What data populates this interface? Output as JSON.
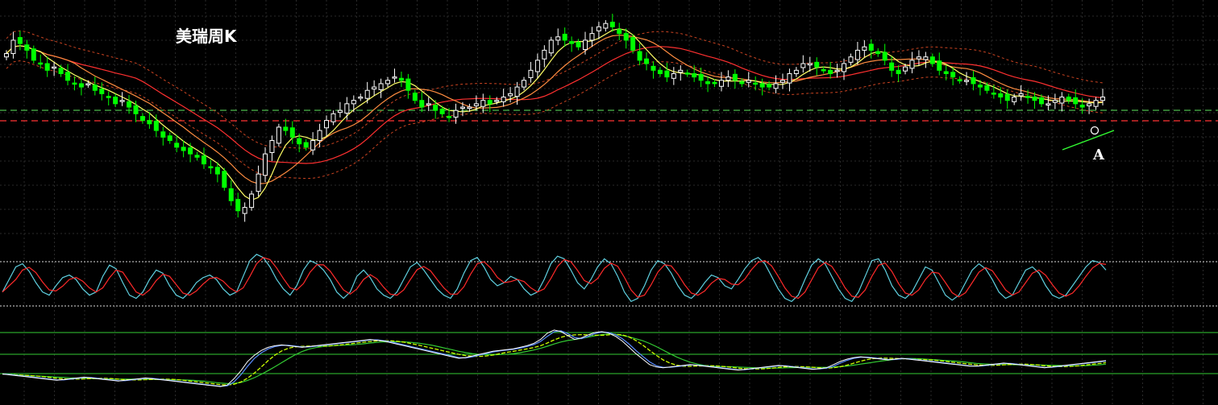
{
  "chart_data": {
    "type": "candlestick",
    "title": "美瑞周K",
    "annotation_label": "A",
    "colors": {
      "background": "#000000",
      "grid": "#2a2a2a",
      "up_candle": "#ffffff",
      "down_candle": "#00ff00",
      "ma_fast": "#ffff66",
      "ma_mid": "#ff8c40",
      "ma_slow": "#ff3030",
      "band": "#cc4422",
      "ref_green": "#4dbb4d",
      "ref_red": "#ff3333",
      "kdj_k": "#5fd0e0",
      "kdj_d": "#ff2a2a",
      "osc_1": "#ffffff",
      "osc_2": "#5a8cff",
      "osc_3": "#ccff00",
      "osc_4": "#33cc33",
      "annotation_line": "#33ff33",
      "annotation_marker": "#ffffff"
    },
    "panels": [
      "price",
      "stochastic",
      "oscillator"
    ],
    "grid": true,
    "close_series": [
      60,
      64,
      63,
      61,
      58,
      57,
      55,
      56,
      54,
      52,
      51,
      50,
      51,
      49,
      48,
      47,
      45,
      46,
      44,
      42,
      40,
      39,
      37,
      35,
      34,
      32,
      31,
      30,
      29,
      27,
      26,
      24,
      20,
      16,
      13,
      14,
      18,
      24,
      30,
      34,
      38,
      37,
      35,
      33,
      32,
      34,
      37,
      40,
      42,
      43,
      45,
      46,
      47,
      49,
      50,
      51,
      52,
      53,
      52,
      49,
      46,
      44,
      45,
      43,
      42,
      41,
      43,
      44,
      44,
      45,
      46,
      45,
      46,
      47,
      48,
      50,
      52,
      55,
      58,
      61,
      64,
      65,
      64,
      63,
      62,
      64,
      66,
      68,
      69,
      68,
      66,
      64,
      61,
      58,
      57,
      55,
      54,
      53,
      54,
      55,
      54,
      53,
      52,
      51,
      51,
      52,
      53,
      52,
      51,
      52,
      51,
      50,
      50,
      51,
      52,
      54,
      55,
      57,
      57,
      56,
      55,
      54,
      55,
      57,
      59,
      61,
      62,
      61,
      60,
      58,
      55,
      54,
      56,
      58,
      59,
      59,
      57,
      55,
      54,
      53,
      52,
      52,
      51,
      50,
      49,
      48,
      47,
      46,
      47,
      48,
      47,
      46,
      45,
      45,
      46,
      47,
      46,
      45,
      44,
      45,
      46,
      47
    ],
    "stochastic_k": [
      35,
      55,
      75,
      80,
      68,
      50,
      35,
      30,
      45,
      58,
      62,
      55,
      40,
      30,
      35,
      60,
      78,
      72,
      50,
      30,
      25,
      35,
      55,
      70,
      65,
      45,
      30,
      25,
      35,
      50,
      58,
      62,
      55,
      40,
      30,
      35,
      60,
      85,
      95,
      90,
      75,
      55,
      40,
      30,
      45,
      70,
      85,
      80,
      70,
      55,
      35,
      25,
      35,
      60,
      70,
      58,
      40,
      30,
      25,
      35,
      55,
      75,
      82,
      70,
      55,
      40,
      30,
      25,
      40,
      65,
      85,
      90,
      75,
      55,
      45,
      50,
      60,
      55,
      40,
      30,
      35,
      55,
      80,
      92,
      88,
      70,
      50,
      40,
      55,
      75,
      88,
      80,
      60,
      35,
      20,
      25,
      45,
      70,
      85,
      80,
      65,
      45,
      30,
      25,
      35,
      50,
      62,
      58,
      45,
      40,
      55,
      72,
      85,
      90,
      80,
      60,
      40,
      25,
      20,
      30,
      55,
      78,
      88,
      80,
      60,
      40,
      25,
      20,
      35,
      60,
      85,
      88,
      70,
      45,
      30,
      25,
      35,
      55,
      75,
      70,
      50,
      30,
      22,
      30,
      50,
      70,
      80,
      72,
      55,
      35,
      25,
      30,
      50,
      70,
      75,
      65,
      45,
      30,
      25,
      30,
      45,
      60,
      75,
      85,
      82,
      70
    ],
    "oscillator": [
      36,
      35,
      34,
      33,
      32,
      31,
      30,
      29,
      28,
      29,
      30,
      31,
      32,
      31,
      30,
      29,
      28,
      27,
      28,
      29,
      30,
      31,
      30,
      29,
      28,
      27,
      26,
      25,
      24,
      23,
      22,
      21,
      20,
      22,
      30,
      40,
      52,
      60,
      66,
      70,
      72,
      73,
      72,
      71,
      70,
      71,
      72,
      73,
      74,
      75,
      76,
      77,
      78,
      79,
      80,
      79,
      78,
      76,
      74,
      72,
      70,
      68,
      66,
      64,
      62,
      60,
      58,
      56,
      57,
      59,
      61,
      63,
      65,
      66,
      67,
      68,
      70,
      72,
      75,
      80,
      88,
      92,
      90,
      85,
      80,
      82,
      86,
      89,
      90,
      88,
      84,
      78,
      70,
      62,
      55,
      48,
      45,
      44,
      45,
      46,
      47,
      48,
      47,
      46,
      45,
      44,
      43,
      42,
      41,
      42,
      43,
      44,
      45,
      46,
      47,
      46,
      45,
      44,
      43,
      42,
      43,
      44,
      48,
      52,
      55,
      57,
      58,
      57,
      56,
      55,
      54,
      55,
      56,
      55,
      54,
      53,
      52,
      51,
      50,
      49,
      48,
      47,
      46,
      46,
      47,
      48,
      49,
      50,
      49,
      48,
      47,
      46,
      45,
      44,
      45,
      46,
      47,
      48,
      49,
      50,
      51,
      52,
      53
    ]
  }
}
